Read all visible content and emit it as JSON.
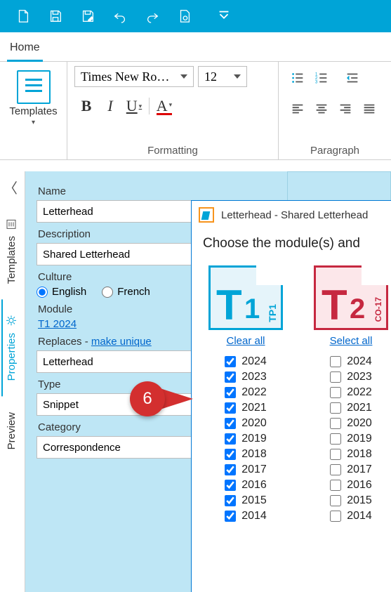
{
  "qat": {
    "icons": [
      "new-file-icon",
      "save-icon",
      "save-as-icon",
      "undo-icon",
      "redo-icon",
      "file-settings-icon",
      "customize-icon"
    ]
  },
  "tabs": {
    "home": "Home"
  },
  "ribbon": {
    "templates_label": "Templates",
    "font_name": "Times New Ro…",
    "font_size": "12",
    "formatting_label": "Formatting",
    "paragraph_label": "Paragraph"
  },
  "side": {
    "templates": "Templates",
    "properties": "Properties",
    "preview": "Preview"
  },
  "props": {
    "name_label": "Name",
    "name_value": "Letterhead",
    "desc_label": "Description",
    "desc_value": "Shared Letterhead",
    "culture_label": "Culture",
    "english": "English",
    "french": "French",
    "module_label": "Module",
    "module_link": "T1 2024",
    "replaces_label": "Replaces - ",
    "replaces_link": "make unique",
    "replaces_value": "Letterhead",
    "type_label": "Type",
    "type_value": "Snippet",
    "category_label": "Category",
    "category_value": "Correspondence"
  },
  "callout": {
    "number": "6"
  },
  "dialog": {
    "title": "Letterhead - Shared Letterhead",
    "prompt": "Choose the module(s) and",
    "t1": {
      "letter": "T",
      "num": "1",
      "side": "TP1",
      "link": "Clear all"
    },
    "t2": {
      "letter": "T",
      "num": "2",
      "side": "CO-17",
      "link": "Select all"
    },
    "years": [
      "2024",
      "2023",
      "2022",
      "2021",
      "2020",
      "2019",
      "2018",
      "2017",
      "2016",
      "2015",
      "2014"
    ]
  }
}
